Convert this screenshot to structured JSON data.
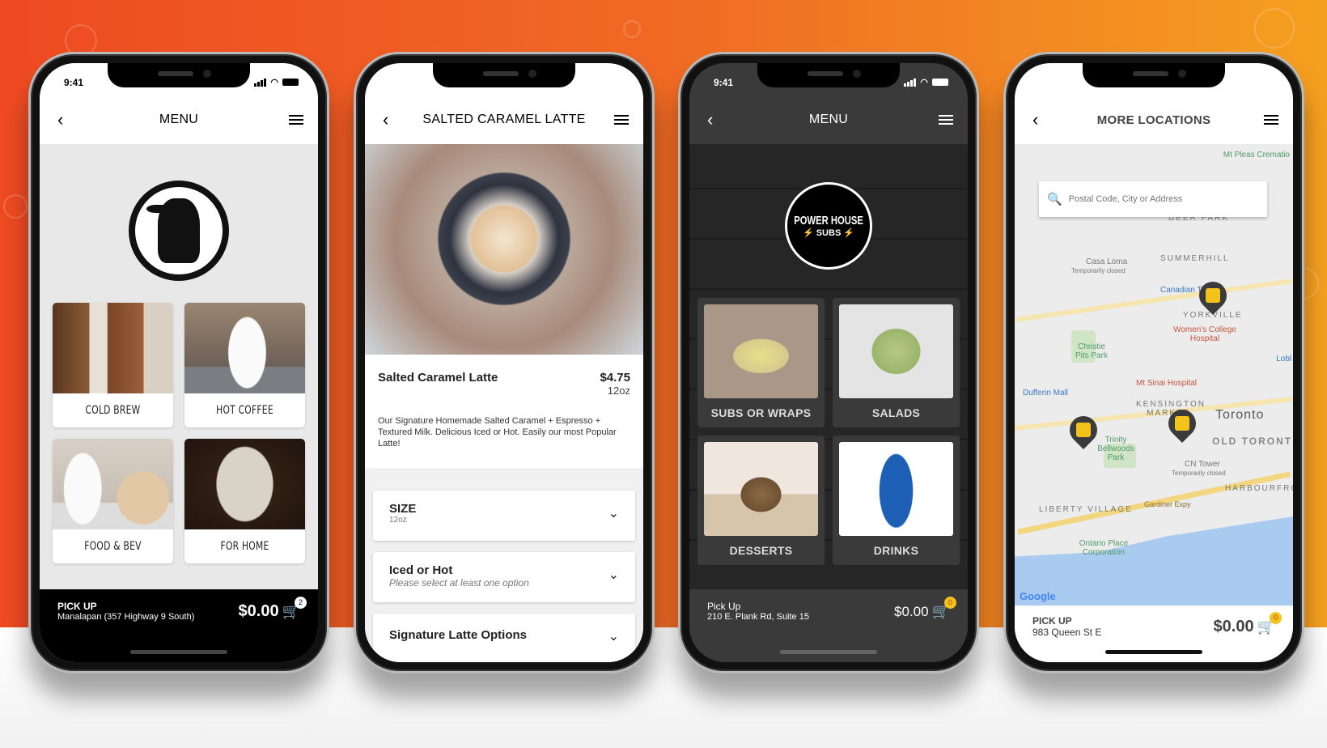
{
  "screens": [
    {
      "status_time": "9:41",
      "title": "MENU",
      "brand_logo": "rook-crow-logo",
      "categories": [
        {
          "label": "COLD BREW",
          "image": "cold-brew-bottles"
        },
        {
          "label": "HOT COFFEE",
          "image": "hot-coffee-cup"
        },
        {
          "label": "FOOD & BEV",
          "image": "coffee-and-bagel"
        },
        {
          "label": "FOR HOME",
          "image": "coffee-bag-beans"
        }
      ],
      "pickup_label": "PICK UP",
      "pickup_address": "Manalapan (357 Highway 9 South)",
      "total": "$0.00",
      "cart_count": "2"
    },
    {
      "title": "SALTED CARAMEL LATTE",
      "item": {
        "name": "Salted Caramel Latte",
        "price": "$4.75",
        "size": "12oz",
        "description": "Our Signature Homemade Salted Caramel + Espresso + Textured Milk. Delicious Iced or Hot. Easily our most Popular Latte!"
      },
      "options": [
        {
          "title": "SIZE",
          "subtitle": "12oz"
        },
        {
          "title": "Iced or Hot",
          "subtitle": "Please select at least one option"
        },
        {
          "title": "Signature Latte Options",
          "subtitle": ""
        }
      ]
    },
    {
      "status_time": "9:41",
      "title": "MENU",
      "brand_logo_line1": "POWER HOUSE",
      "brand_logo_line2": "SUBS",
      "categories": [
        {
          "label": "SUBS OR WRAPS",
          "image": "sub-sandwich"
        },
        {
          "label": "SALADS",
          "image": "salad"
        },
        {
          "label": "DESSERTS",
          "image": "dessert"
        },
        {
          "label": "DRINKS",
          "image": "pepsi-can"
        }
      ],
      "pickup_label": "Pick Up",
      "pickup_address": "210 E. Plank Rd, Suite 15",
      "total": "$0.00",
      "cart_count": "0"
    },
    {
      "title": "MORE LOCATIONS",
      "search_placeholder": "Postal Code, City or Address",
      "map_labels": {
        "deer_park": "DEER PARK",
        "summerhill": "SUMMERHILL",
        "casa_loma": "Casa Loma",
        "casa_loma_sub": "Temporarily closed",
        "canadian_tire": "Canadian Ti",
        "yorkville": "YORKVILLE",
        "womens_college": "Women's College Hospital",
        "christie_pits": "Christie Pits Park",
        "loblaws": "Lobl",
        "mt_sinai": "Mt Sinai Hospital",
        "dufferin_mall": "Dufferin Mall",
        "kensington": "KENSINGTON MARKET",
        "toronto": "Toronto",
        "old_toronto": "OLD TORONT",
        "trinity": "Trinity Bellwoods Park",
        "cn_tower": "CN Tower",
        "cn_tower_sub": "Temporarily closed",
        "harbourfront": "HARBOURFRO",
        "liberty_village": "LIBERTY VILLAGE",
        "gardiner": "Gardiner Expy",
        "ontario_place": "Ontario Place Corporation",
        "mt_pleasant": "Mt Pleas Crematio",
        "google": "Google"
      },
      "pickup_label": "PICK UP",
      "pickup_address": "983 Queen St E",
      "total": "$0.00",
      "cart_count": "0"
    }
  ],
  "colors": {
    "bg_orange_left": "#ee4a22",
    "bg_orange_right": "#f5a020",
    "marker_yellow": "#f3c21b",
    "dark_gray": "#3a3a3a"
  }
}
